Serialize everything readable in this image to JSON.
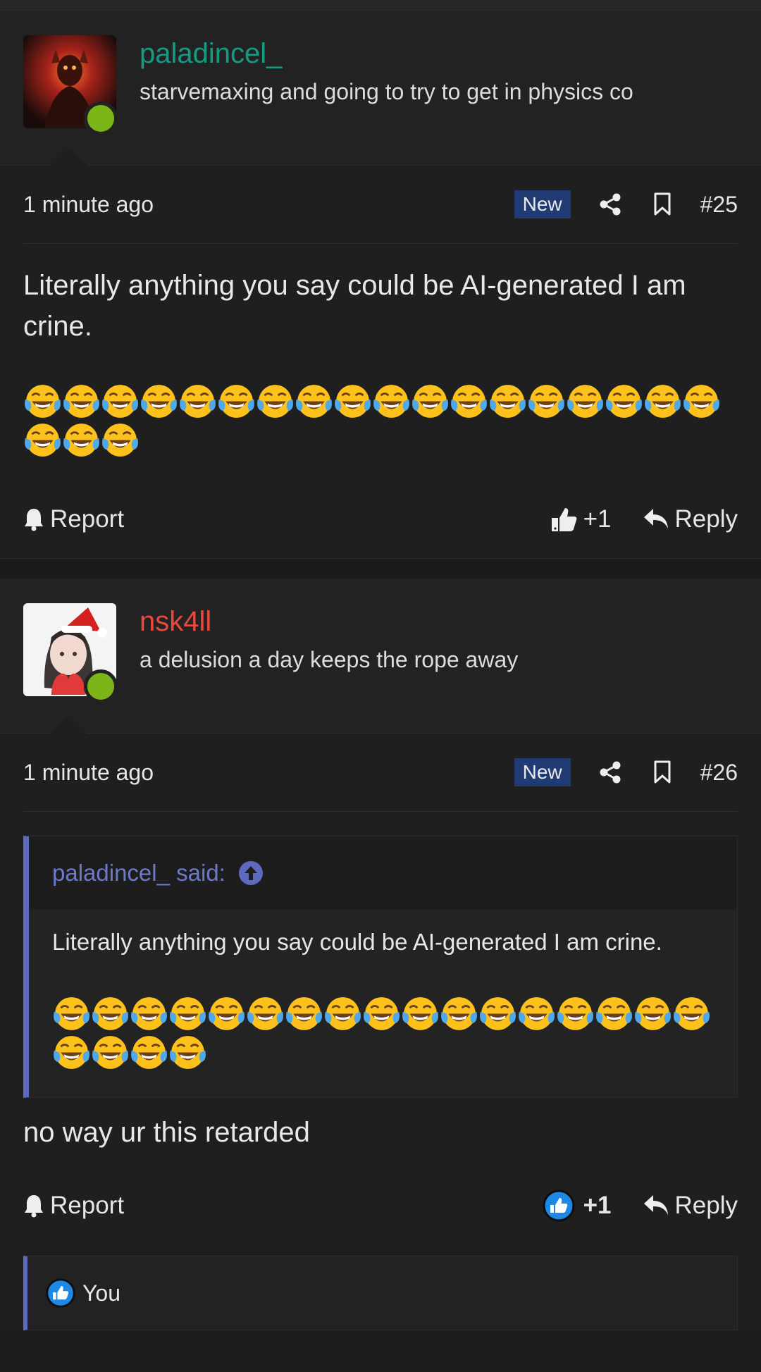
{
  "posts": [
    {
      "username": "paladincel_",
      "user_title": "starvemaxing and going to try to get in physics co",
      "time": "1 minute ago",
      "badge": "New",
      "number": "#25",
      "message": "Literally anything you say could be AI-generated I am crine.",
      "emoji_count": 21,
      "report_label": "Report",
      "like_count": "+1",
      "reply_label": "Reply"
    },
    {
      "username": "nsk4ll",
      "user_title": "a delusion a day keeps the rope away",
      "time": "1 minute ago",
      "badge": "New",
      "number": "#26",
      "quote": {
        "author": "paladincel_ said:",
        "text": "Literally anything you say could be AI-generated I am crine.",
        "emoji_count": 21
      },
      "message": "no way ur this retarded",
      "report_label": "Report",
      "like_count": "+1",
      "reply_label": "Reply",
      "reactions_label": "You"
    }
  ],
  "colors": {
    "username_1": "#169a84",
    "username_2": "#e8493e",
    "online": "#7cb518",
    "new_badge": "#203a74",
    "quote_accent": "#5c6bc0",
    "like_active": "#1e88e5"
  },
  "icons": [
    "share-icon",
    "bookmark-icon",
    "bell-icon",
    "thumbs-up-icon",
    "reply-icon",
    "arrow-up-circle-icon",
    "laughing-crying-emoji"
  ]
}
